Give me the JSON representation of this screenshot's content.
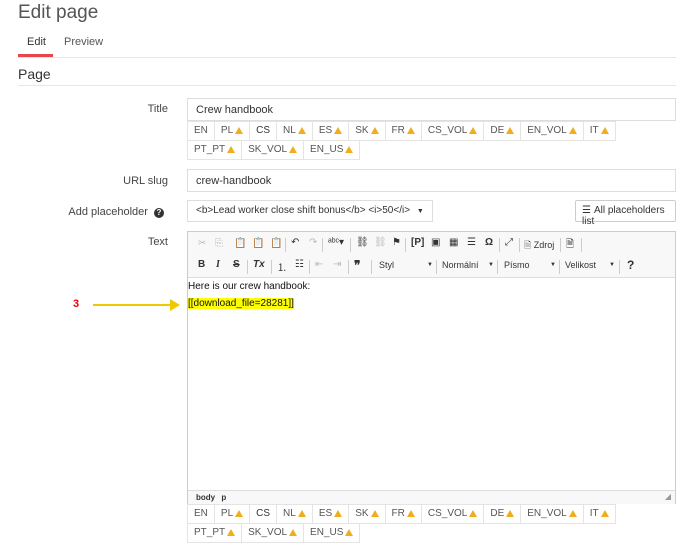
{
  "page": {
    "title": "Edit page",
    "section": "Page"
  },
  "tabs": [
    {
      "label": "Edit"
    },
    {
      "label": "Preview"
    }
  ],
  "fields": {
    "title": {
      "label": "Title",
      "value": "Crew handbook"
    },
    "slug": {
      "label": "URL slug",
      "value": "crew-handbook"
    },
    "placeholder": {
      "label": "Add placeholder",
      "value": "<b>Lead worker close shift bonus</b> <i>50</i>",
      "button": "All placeholders list"
    },
    "text": {
      "label": "Text"
    }
  },
  "languages": [
    {
      "code": "EN",
      "warn": false
    },
    {
      "code": "PL",
      "warn": true
    },
    {
      "code": "CS",
      "warn": false
    },
    {
      "code": "NL",
      "warn": true
    },
    {
      "code": "ES",
      "warn": true
    },
    {
      "code": "SK",
      "warn": true
    },
    {
      "code": "FR",
      "warn": true
    },
    {
      "code": "CS_VOL",
      "warn": true
    },
    {
      "code": "DE",
      "warn": true
    },
    {
      "code": "EN_VOL",
      "warn": true
    },
    {
      "code": "IT",
      "warn": true
    },
    {
      "code": "PT_PT",
      "warn": true
    },
    {
      "code": "SK_VOL",
      "warn": true
    },
    {
      "code": "EN_US",
      "warn": true
    }
  ],
  "toolbar": {
    "source_label": "Zdroj",
    "format_styles": "Styl",
    "format_block": "Normální",
    "font": "Písmo",
    "size": "Velikost"
  },
  "editor": {
    "line1": "Here is our crew handbook:",
    "line2": "[[download_file=28281]]",
    "status_body": "body",
    "status_p": "p"
  },
  "annotation": {
    "marker": "3",
    "color": "#f0c800",
    "marker_color": "#ee0000"
  },
  "colors": {
    "accent": "#e8464c",
    "warning": "#f0ad1c",
    "highlight": "#ffff00"
  }
}
